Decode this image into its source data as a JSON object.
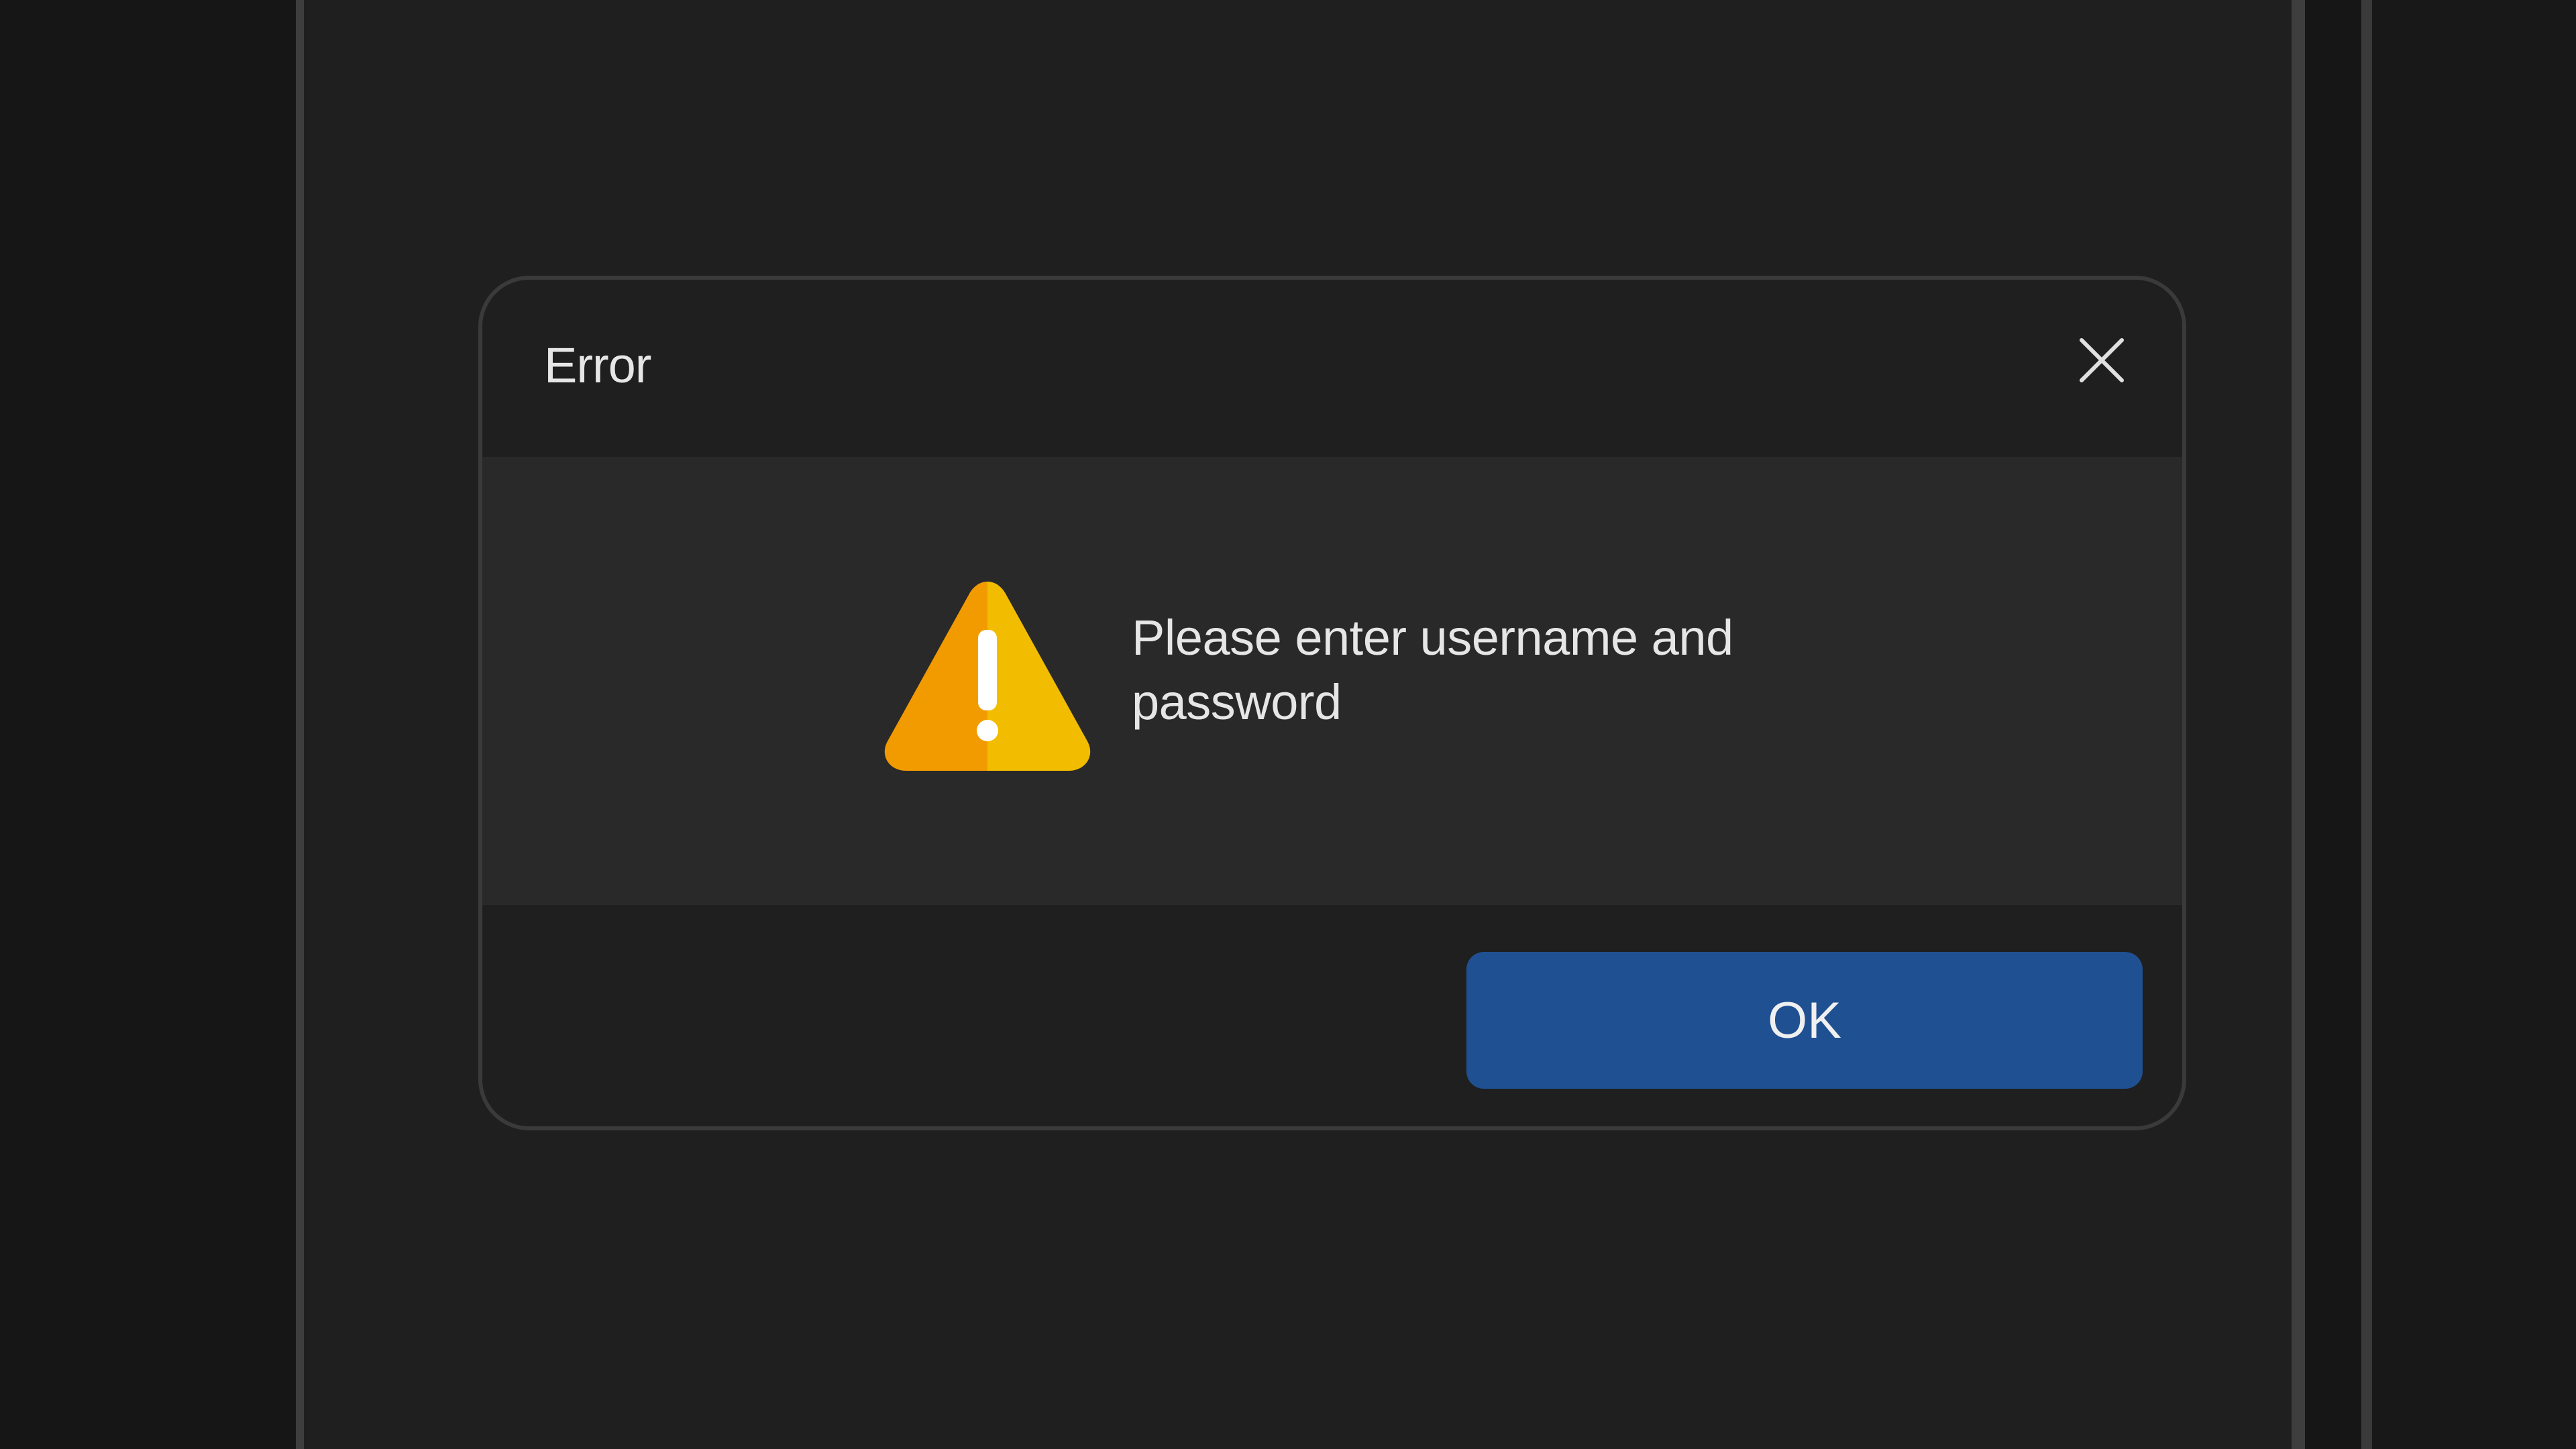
{
  "dialog": {
    "title": "Error",
    "close_icon": "close-icon",
    "warning_icon": "warning-triangle-icon",
    "message": "Please enter username and password",
    "ok_label": "OK"
  },
  "colors": {
    "page_background": "#161616",
    "dialog_background": "#1f1f1f",
    "body_background": "#292929",
    "button_background": "#1f5091",
    "warning_orange": "#f29b00",
    "warning_yellow": "#f2bd00",
    "text": "#e6e6e6"
  }
}
